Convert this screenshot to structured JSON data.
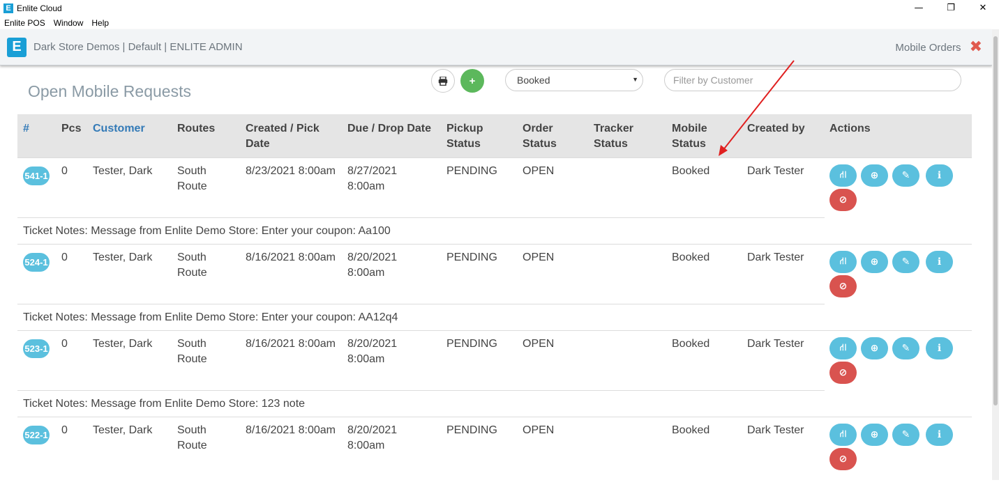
{
  "window": {
    "title": "Enlite Cloud",
    "app_icon_letter": "E",
    "controls": {
      "minimize": "—",
      "restore": "❐",
      "close": "✕"
    }
  },
  "menu": [
    "Enlite POS",
    "Window",
    "Help"
  ],
  "header": {
    "logo_letter": "E",
    "brand": "Dark Store Demos | Default | ENLITE ADMIN",
    "section": "Mobile Orders",
    "close_glyph": "✖"
  },
  "toolbar": {
    "title": "Open Mobile Requests",
    "print_icon": "printer-icon",
    "add_label": "+",
    "status_value": "Booked",
    "filter_placeholder": "Filter by Customer"
  },
  "columns": [
    "#",
    "Pcs",
    "Customer",
    "Routes",
    "Created / Pick Date",
    "Due / Drop Date",
    "Pickup Status",
    "Order Status",
    "Tracker Status",
    "Mobile Status",
    "Created by",
    "Actions"
  ],
  "rows": [
    {
      "id": "541-1",
      "pcs": "0",
      "customer": "Tester, Dark",
      "route": "South Route",
      "created": "8/23/2021 8:00am",
      "due": "8/27/2021 8:00am",
      "pickup": "PENDING",
      "order": "OPEN",
      "tracker": "",
      "mobile": "Booked",
      "created_by": "Dark Tester",
      "note": "Ticket Notes: Message from Enlite Demo Store: Enter your coupon: Aa100"
    },
    {
      "id": "524-1",
      "pcs": "0",
      "customer": "Tester, Dark",
      "route": "South Route",
      "created": "8/16/2021 8:00am",
      "due": "8/20/2021 8:00am",
      "pickup": "PENDING",
      "order": "OPEN",
      "tracker": "",
      "mobile": "Booked",
      "created_by": "Dark Tester",
      "note": "Ticket Notes: Message from Enlite Demo Store: Enter your coupon: AA12q4"
    },
    {
      "id": "523-1",
      "pcs": "0",
      "customer": "Tester, Dark",
      "route": "South Route",
      "created": "8/16/2021 8:00am",
      "due": "8/20/2021 8:00am",
      "pickup": "PENDING",
      "order": "OPEN",
      "tracker": "",
      "mobile": "Booked",
      "created_by": "Dark Tester",
      "note": "Ticket Notes: Message from Enlite Demo Store: 123 note"
    },
    {
      "id": "522-1",
      "pcs": "0",
      "customer": "Tester, Dark",
      "route": "South Route",
      "created": "8/16/2021 8:00am",
      "due": "8/20/2021 8:00am",
      "pickup": "PENDING",
      "order": "OPEN",
      "tracker": "",
      "mobile": "Booked",
      "created_by": "Dark Tester",
      "note": ""
    }
  ],
  "colors": {
    "accent": "#5bc0de",
    "danger": "#d9534f",
    "success": "#5cb85c",
    "brand": "#1a9fd6",
    "annotation": "#e02020"
  }
}
